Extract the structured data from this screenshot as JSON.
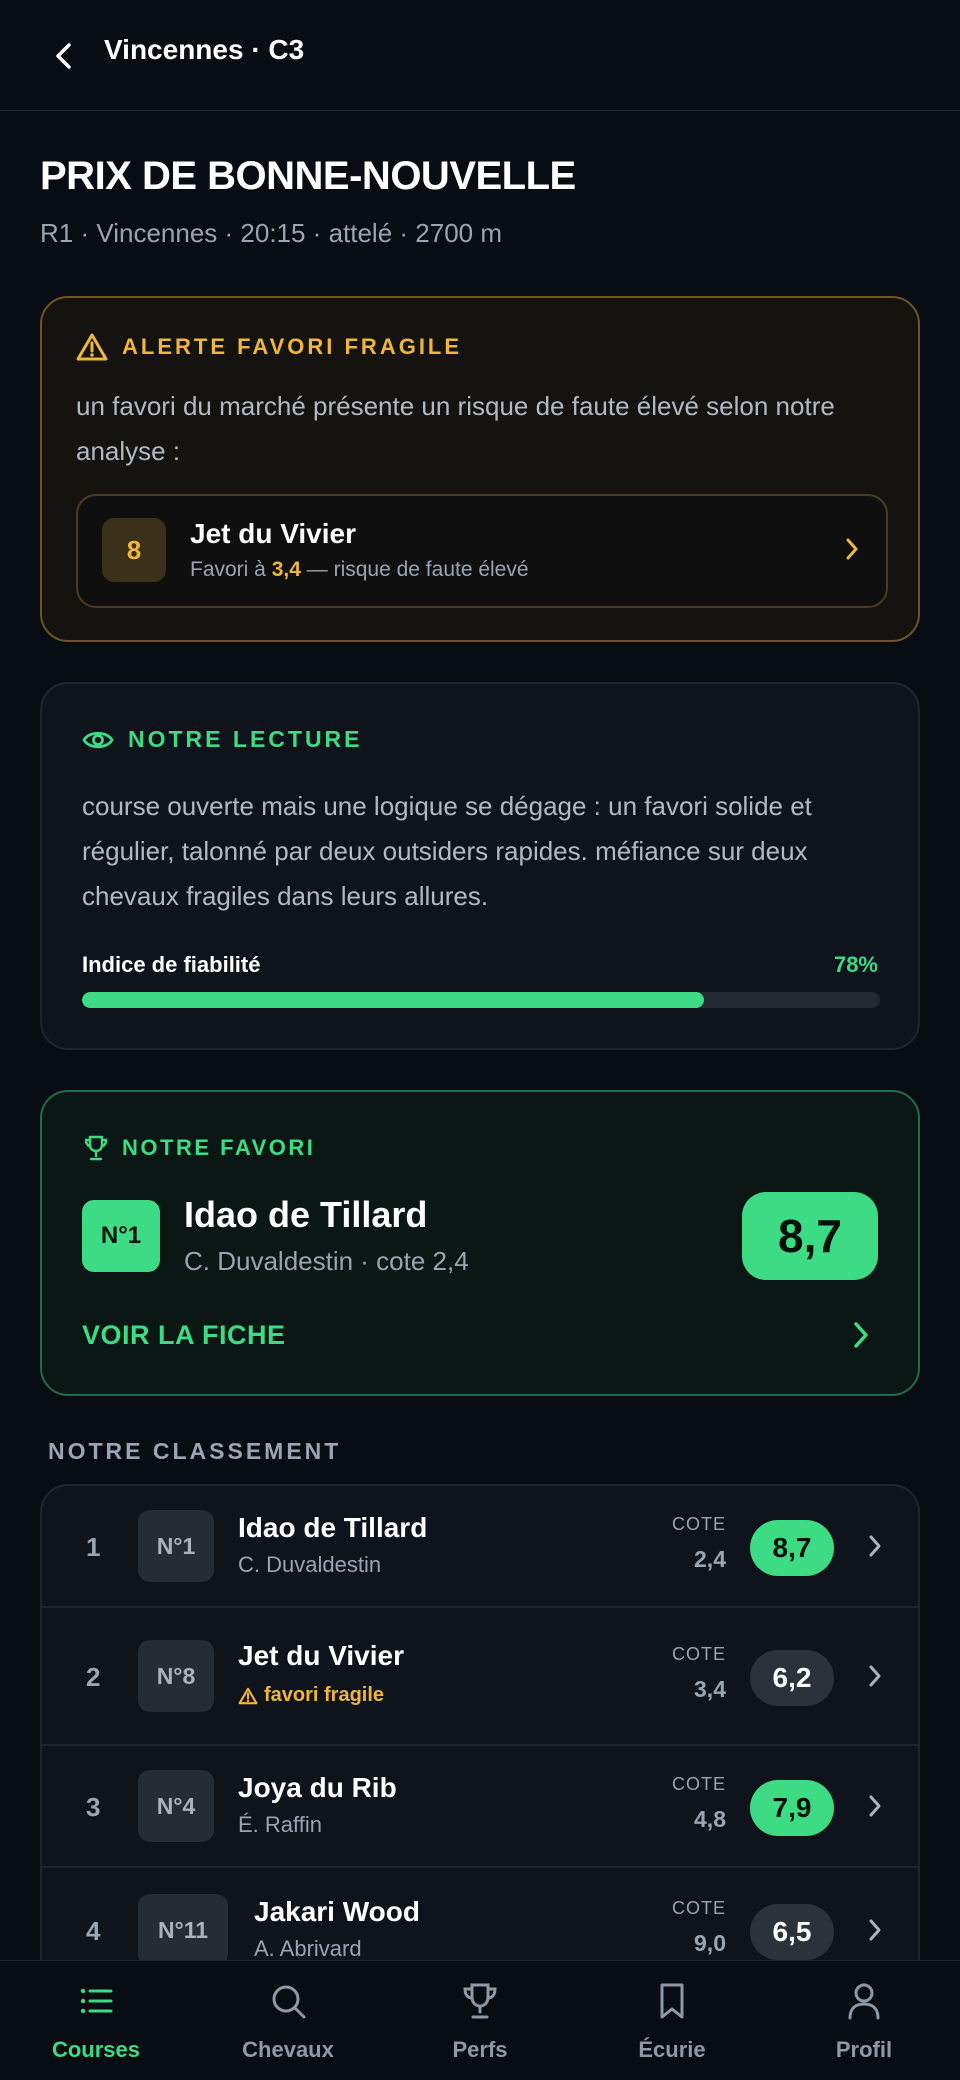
{
  "header": {
    "title": "Vincennes · C3"
  },
  "race": {
    "title": "PRIX DE BONNE-NOUVELLE",
    "meta": "R1 · Vincennes · 20:15 · attelé · 2700 m"
  },
  "alert": {
    "label": "ALERTE FAVORI FRAGILE",
    "text": "un favori du marché présente un risque de faute élevé selon notre analyse :",
    "horse": {
      "number": "8",
      "name": "Jet du Vivier",
      "sub_prefix": "Favori à ",
      "odds": "3,4",
      "sub_suffix": " — risque de faute élevé"
    }
  },
  "lecture": {
    "label": "NOTRE LECTURE",
    "text": "course ouverte mais une logique se dégage : un favori solide et régulier, talonné par deux outsiders rapides. méfiance sur deux chevaux fragiles dans leurs allures.",
    "reliability_label": "Indice de fiabilité",
    "reliability_value": "78%",
    "reliability_fraction": 0.78
  },
  "favorite": {
    "label": "NOTRE FAVORI",
    "number": "N°1",
    "name": "Idao de Tillard",
    "sub": "C. Duvaldestin · cote 2,4",
    "score": "8,7",
    "link": "VOIR LA FICHE"
  },
  "ranking": {
    "title": "NOTRE CLASSEMENT",
    "cote_label": "COTE",
    "rows": [
      {
        "pos": "1",
        "number": "N°1",
        "name": "Idao de Tillard",
        "sub": "C. Duvaldestin",
        "cote": "2,4",
        "score": "8,7"
      },
      {
        "pos": "2",
        "number": "N°8",
        "name": "Jet du Vivier",
        "sub": "favori fragile",
        "cote": "3,4",
        "score": "6,2"
      },
      {
        "pos": "3",
        "number": "N°4",
        "name": "Joya du Rib",
        "sub": "É. Raffin",
        "cote": "4,8",
        "score": "7,9"
      },
      {
        "pos": "4",
        "number": "N°11",
        "name": "Jakari Wood",
        "sub": "A. Abrivard",
        "cote": "9,0",
        "score": "6,5"
      }
    ]
  },
  "tabs": [
    {
      "label": "Courses",
      "icon": "list-icon"
    },
    {
      "label": "Chevaux",
      "icon": "search-icon"
    },
    {
      "label": "Perfs",
      "icon": "trophy-icon"
    },
    {
      "label": "Écurie",
      "icon": "bookmark-icon"
    },
    {
      "label": "Profil",
      "icon": "user-icon"
    }
  ],
  "colors": {
    "accent": "#3ddb84",
    "warning": "#f0b53c",
    "background": "#080d14",
    "card": "#0f141c"
  }
}
